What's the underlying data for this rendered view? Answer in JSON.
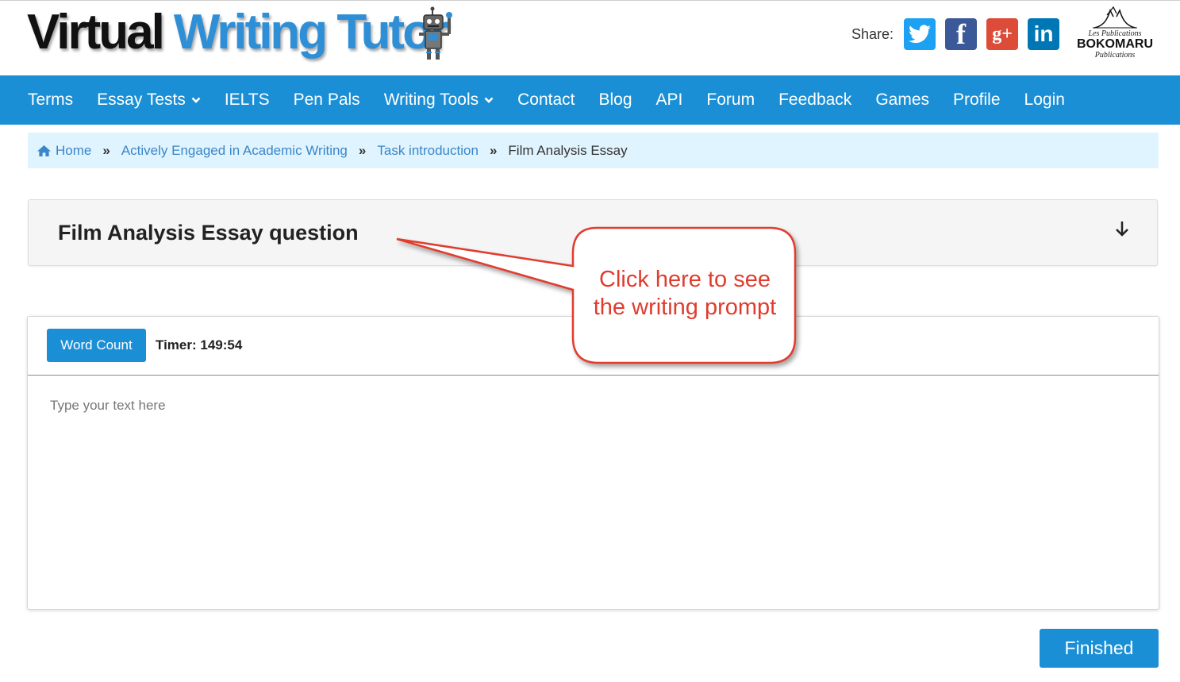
{
  "header": {
    "logo_word1": "Virtual",
    "logo_word2": "Writing Tutor",
    "share_label": "Share:",
    "social": [
      {
        "name": "twitter",
        "icon": "twitter-icon",
        "color": "#1da1f2"
      },
      {
        "name": "facebook",
        "icon": "facebook-icon",
        "glyph": "f",
        "color": "#3b5998"
      },
      {
        "name": "google-plus",
        "icon": "google-plus-icon",
        "glyph": "g+",
        "color": "#dd4b39"
      },
      {
        "name": "linkedin",
        "icon": "linkedin-icon",
        "glyph": "in",
        "color": "#0077b5"
      }
    ],
    "publisher": {
      "line1": "Les Publications",
      "line2": "BOKOMARU",
      "line3": "Publications"
    }
  },
  "nav": {
    "items": [
      {
        "label": "Terms"
      },
      {
        "label": "Essay Tests",
        "dropdown": true
      },
      {
        "label": "IELTS"
      },
      {
        "label": "Pen Pals"
      },
      {
        "label": "Writing Tools",
        "dropdown": true
      },
      {
        "label": "Contact"
      },
      {
        "label": "Blog"
      },
      {
        "label": "API"
      },
      {
        "label": "Forum"
      },
      {
        "label": "Feedback"
      },
      {
        "label": "Games"
      },
      {
        "label": "Profile"
      },
      {
        "label": "Login"
      }
    ],
    "color": "#1a8fd6"
  },
  "breadcrumb": {
    "home": "Home",
    "items": [
      "Actively Engaged in Academic Writing",
      "Task introduction"
    ],
    "current": "Film Analysis Essay",
    "separator": "»"
  },
  "accordion": {
    "title": "Film Analysis Essay question",
    "icon": "arrow-down-icon"
  },
  "editor": {
    "word_count_label": "Word Count",
    "timer": "Timer: 149:54",
    "placeholder": "Type your text here",
    "value": ""
  },
  "finished_label": "Finished",
  "callout": {
    "line1": "Click here to see",
    "line2": "the writing prompt",
    "color": "#e03c2e"
  }
}
